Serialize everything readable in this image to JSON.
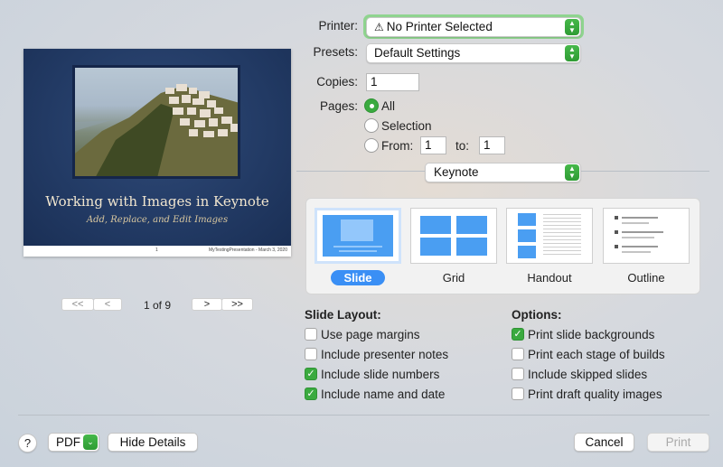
{
  "printer": {
    "label": "Printer:",
    "value": "No Printer Selected",
    "warning_glyph": "⚠"
  },
  "presets": {
    "label": "Presets:",
    "value": "Default Settings"
  },
  "copies": {
    "label": "Copies:",
    "value": "1"
  },
  "pages": {
    "label": "Pages:",
    "all": "All",
    "selection": "Selection",
    "from_label": "From:",
    "from_value": "1",
    "to_label": "to:",
    "to_value": "1",
    "selected": "All"
  },
  "app_menu": {
    "value": "Keynote"
  },
  "layouts": [
    {
      "label": "Slide",
      "selected": true
    },
    {
      "label": "Grid",
      "selected": false
    },
    {
      "label": "Handout",
      "selected": false
    },
    {
      "label": "Outline",
      "selected": false
    }
  ],
  "slide_layout": {
    "title": "Slide Layout:",
    "items": [
      {
        "label": "Use page margins",
        "checked": false
      },
      {
        "label": "Include presenter notes",
        "checked": false
      },
      {
        "label": "Include slide numbers",
        "checked": true
      },
      {
        "label": "Include name and date",
        "checked": true
      }
    ]
  },
  "options": {
    "title": "Options:",
    "items": [
      {
        "label": "Print slide backgrounds",
        "checked": true
      },
      {
        "label": "Print each stage of builds",
        "checked": false
      },
      {
        "label": "Include skipped slides",
        "checked": false
      },
      {
        "label": "Print draft quality images",
        "checked": false
      }
    ]
  },
  "preview": {
    "slide_title": "Working with Images in Keynote",
    "slide_subtitle": "Add, Replace, and Edit Images",
    "footer_page": "1",
    "footer_right": "MyTestingPresentation - March 3, 2020",
    "page_indicator": "1 of 9",
    "first_glyph": "<<",
    "prev_glyph": "<",
    "next_glyph": ">",
    "last_glyph": ">>"
  },
  "footer": {
    "help": "?",
    "pdf": "PDF",
    "hide_details": "Hide Details",
    "cancel": "Cancel",
    "print": "Print"
  },
  "colors": {
    "accent": "#3aaa3f",
    "selection_blue": "#3a8ff5"
  }
}
